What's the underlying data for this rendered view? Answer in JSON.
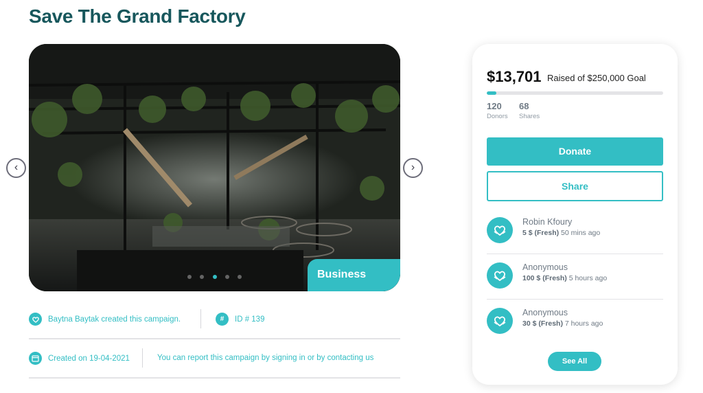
{
  "campaign": {
    "title": "Save The Grand Factory",
    "category": "Business",
    "creator_text": "Baytna Baytak created this campaign.",
    "id_text": "ID # 139",
    "created_text": "Created on 19-04-2021",
    "report_text": "You can report this campaign by signing in or by contacting us"
  },
  "gallery": {
    "slide_count": 5,
    "active_slide": 2,
    "prev_label": "‹",
    "next_label": "›"
  },
  "donation_card": {
    "raised": "$13,701",
    "goal_text": "Raised of $250,000 Goal",
    "progress_fraction": 0.055,
    "donors_count": "120",
    "donors_label": "Donors",
    "shares_count": "68",
    "shares_label": "Shares",
    "donate_label": "Donate",
    "share_label": "Share",
    "see_all_label": "See All"
  },
  "donations": [
    {
      "name": "Robin Kfoury",
      "amount": "5 $ (Fresh)",
      "time": "50 mins ago"
    },
    {
      "name": "Anonymous",
      "amount": "100 $ (Fresh)",
      "time": "5 hours ago"
    },
    {
      "name": "Anonymous",
      "amount": "30 $ (Fresh)",
      "time": "7 hours ago"
    }
  ],
  "icons": {
    "creator": "heart-hands-icon",
    "id": "hash-icon",
    "created": "calendar-icon",
    "donor": "heart-hands-icon"
  },
  "colors": {
    "accent": "#33bec4",
    "title": "#17575c"
  }
}
